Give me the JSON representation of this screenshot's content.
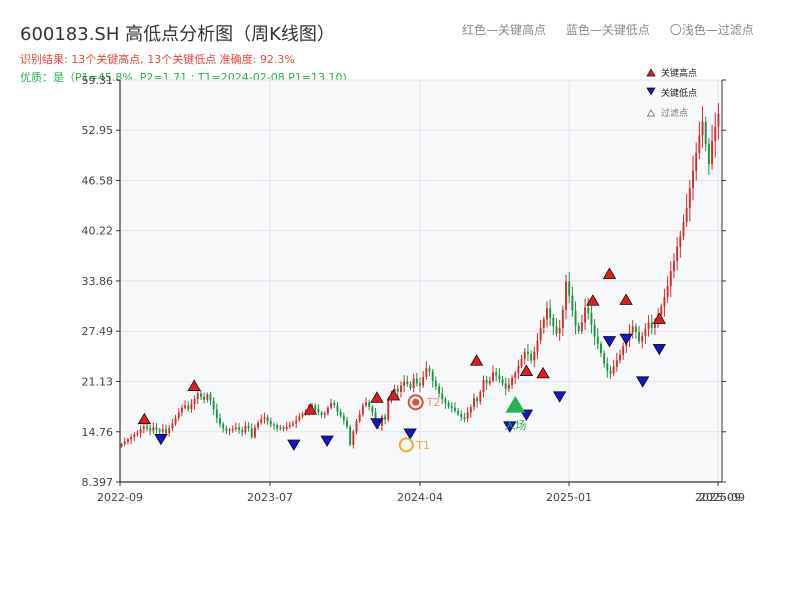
{
  "header": {
    "title": "600183.SH 高低点分析图（周K线图）",
    "result_line": "识别结果: 13个关键高点, 13个关键低点  准确度: 92.3%",
    "quality_line": "优质：是（P1=45.8%, P2=1.71 ; T1=2024-02-08 P1=13.10)",
    "top_legend": [
      "红色—关键高点",
      "蓝色—关键低点",
      "〇浅色—过滤点"
    ]
  },
  "colors": {
    "up": "#d42b2b",
    "down": "#1a9640",
    "high_marker": "#e41a1c",
    "low_marker": "#1414c8",
    "t_marker": "#f5a623",
    "t2_marker": "#e8483c",
    "entry_marker": "#2bb050",
    "plot_bg": "#f7f8fa",
    "grid": "#dcdfe6",
    "axis": "#333333"
  },
  "chart_data": {
    "type": "candlestick",
    "x_tick_labels": [
      "2022-09",
      "2023-07",
      "2024-04",
      "2025-01",
      "2025-09"
    ],
    "x_tick_labels_overlap": "2025-09",
    "y_tick_labels": [
      "8.397",
      "14.76",
      "21.13",
      "27.49",
      "33.86",
      "40.22",
      "46.58",
      "52.95",
      "59.31"
    ],
    "ylim": [
      8.397,
      59.31
    ],
    "grid": true,
    "legend": {
      "position": "top-right",
      "entries": [
        {
          "label": "关键高点",
          "marker": "triangle-up",
          "color": "#e41a1c"
        },
        {
          "label": "关键低点",
          "marker": "triangle-down",
          "color": "#1414c8"
        },
        {
          "label": "过滤点",
          "marker": "triangle-up-hollow",
          "color": "#888888"
        }
      ]
    },
    "candles_weekly_closes": [
      13.2,
      13.5,
      13.8,
      14.1,
      14.4,
      14.6,
      15.1,
      15.4,
      15.2,
      14.9,
      15.3,
      15.0,
      14.8,
      15.1,
      14.6,
      15.2,
      15.8,
      16.5,
      17.2,
      17.8,
      18.1,
      17.6,
      18.3,
      18.9,
      19.6,
      19.2,
      18.8,
      19.5,
      18.7,
      17.6,
      16.5,
      15.7,
      15.2,
      14.9,
      15.0,
      15.1,
      15.3,
      15.0,
      14.7,
      15.5,
      15.2,
      14.1,
      15.3,
      15.9,
      16.4,
      16.6,
      16.1,
      15.7,
      15.6,
      15.2,
      15.3,
      15.1,
      15.4,
      15.6,
      15.8,
      16.2,
      16.7,
      17.0,
      17.3,
      17.9,
      18.1,
      17.6,
      17.2,
      16.9,
      17.1,
      17.8,
      18.4,
      18.1,
      17.3,
      16.8,
      16.2,
      15.4,
      13.1,
      14.8,
      16.1,
      17.0,
      18.1,
      18.5,
      17.9,
      17.2,
      16.0,
      15.5,
      16.7,
      16.3,
      18.9,
      19.5,
      20.2,
      19.8,
      20.6,
      21.1,
      20.8,
      20.3,
      21.5,
      20.9,
      20.6,
      21.7,
      22.8,
      22.4,
      21.2,
      20.5,
      19.6,
      18.9,
      18.4,
      18.0,
      17.8,
      17.4,
      17.0,
      16.6,
      16.4,
      17.2,
      17.9,
      19.0,
      18.6,
      19.8,
      21.3,
      20.9,
      21.2,
      22.3,
      21.9,
      21.4,
      20.9,
      20.2,
      20.7,
      21.6,
      22.2,
      23.1,
      24.0,
      24.9,
      24.6,
      23.8,
      24.9,
      26.3,
      27.9,
      29.0,
      30.4,
      29.2,
      28.1,
      27.2,
      27.9,
      30.2,
      33.8,
      32.0,
      30.1,
      28.2,
      27.5,
      28.6,
      30.5,
      29.8,
      28.3,
      26.8,
      25.9,
      24.7,
      23.4,
      22.5,
      22.1,
      23.0,
      23.8,
      24.5,
      25.6,
      26.4,
      27.3,
      28.1,
      27.4,
      26.2,
      26.9,
      27.8,
      28.6,
      27.9,
      28.4,
      29.5,
      30.6,
      31.8,
      33.2,
      35.1,
      36.4,
      38.2,
      39.5,
      41.3,
      43.1,
      45.6,
      47.8,
      50.1,
      52.3,
      54.0,
      51.2,
      48.7,
      51.6,
      53.4,
      55.0
    ],
    "key_highs": [
      {
        "date": "2022-10",
        "value": 15.4
      },
      {
        "date": "2023-01",
        "value": 19.6
      },
      {
        "date": "2023-08",
        "value": 16.6
      },
      {
        "date": "2023-12",
        "value": 18.1
      },
      {
        "date": "2024-01",
        "value": 18.4
      },
      {
        "date": "2024-06",
        "value": 22.8
      },
      {
        "date": "2024-09",
        "value": 21.5
      },
      {
        "date": "2024-10",
        "value": 21.2
      },
      {
        "date": "2025-01",
        "value": 30.4
      },
      {
        "date": "2025-02",
        "value": 33.8
      },
      {
        "date": "2025-03",
        "value": 30.5
      },
      {
        "date": "2025-05",
        "value": 28.1
      }
    ],
    "key_lows": [
      {
        "date": "2022-11",
        "value": 14.8
      },
      {
        "date": "2023-07",
        "value": 14.1
      },
      {
        "date": "2023-09",
        "value": 14.6
      },
      {
        "date": "2023-12",
        "value": 16.8
      },
      {
        "date": "2024-02",
        "value": 15.5
      },
      {
        "date": "2024-08",
        "value": 16.4
      },
      {
        "date": "2024-09",
        "value": 17.9
      },
      {
        "date": "2024-11",
        "value": 20.2
      },
      {
        "date": "2025-02",
        "value": 27.2
      },
      {
        "date": "2025-03",
        "value": 27.5
      },
      {
        "date": "2025-04",
        "value": 22.1
      },
      {
        "date": "2025-05",
        "value": 26.2
      }
    ],
    "annotations": {
      "t1": {
        "label": "T1",
        "date": "2024-02-08",
        "value": 13.1
      },
      "t2": {
        "label": "T2",
        "value": 18.5
      },
      "entry": {
        "label": "入场",
        "value": 18.0
      }
    }
  }
}
